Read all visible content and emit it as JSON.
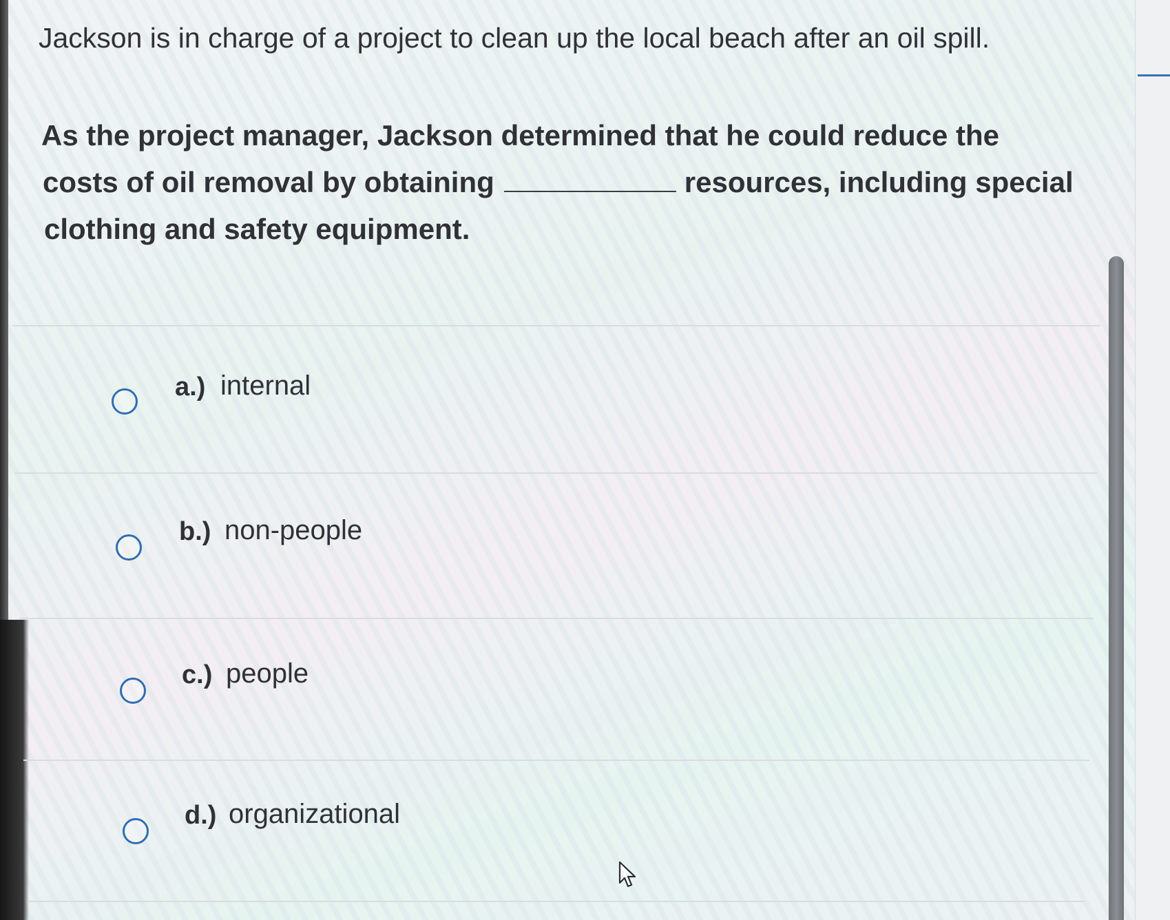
{
  "question": {
    "intro": "Jackson is in charge of a project to clean up the local beach after an oil spill.",
    "stem_line_1": "As the project manager, Jackson determined that he could reduce the",
    "stem_line_2_before_blank": "costs of oil removal by obtaining",
    "stem_line_2_after_blank": "resources, including special",
    "stem_line_3": "clothing and safety equipment."
  },
  "options": [
    {
      "letter": "a.)",
      "text": "internal",
      "selected": false
    },
    {
      "letter": "b.)",
      "text": "non-people",
      "selected": false
    },
    {
      "letter": "c.)",
      "text": "people",
      "selected": false
    },
    {
      "letter": "d.)",
      "text": "organizational",
      "selected": false
    }
  ],
  "colors": {
    "radio_border": "#2f6db0",
    "text": "#2f3136",
    "divider": "#d9dcdf",
    "scrollbar": "#7d8185",
    "accent": "#3c6fb5"
  },
  "icons": {
    "radio": "radio-unselected-icon",
    "cursor": "mouse-pointer-icon"
  }
}
